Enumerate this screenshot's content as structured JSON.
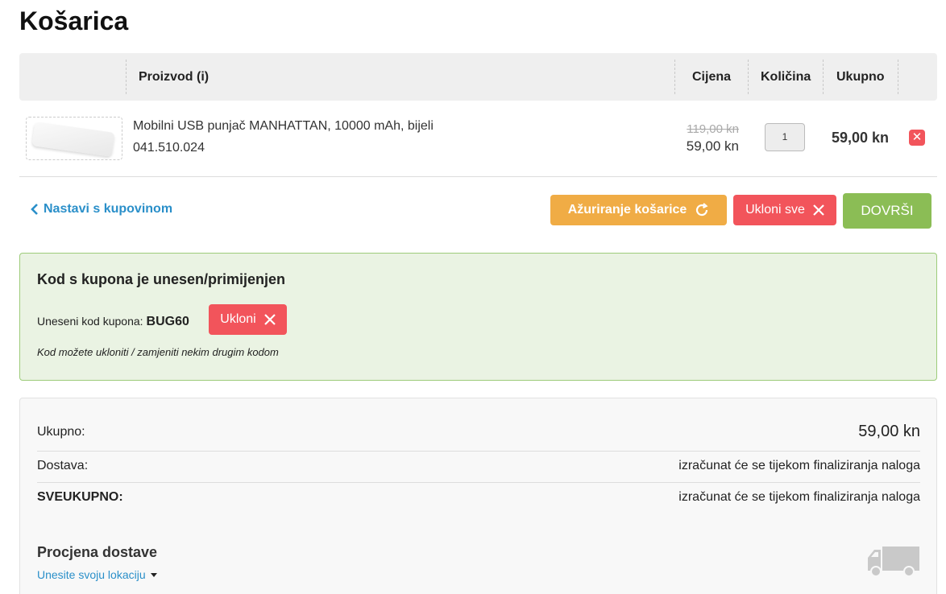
{
  "page": {
    "title": "Košarica"
  },
  "table": {
    "headers": {
      "product": "Proizvod (i)",
      "price": "Cijena",
      "qty": "Količina",
      "total": "Ukupno"
    },
    "rows": [
      {
        "name": "Mobilni USB punjač MANHATTAN, 10000 mAh, bijeli",
        "code": "041.510.024",
        "old_price": "119,00 kn",
        "price": "59,00 kn",
        "quantity": "1",
        "total": "59,00 kn"
      }
    ]
  },
  "actions": {
    "continue": "Nastavi s kupovinom",
    "update": "Ažuriranje košarice",
    "remove_all": "Ukloni sve",
    "finish": "DOVRŠI"
  },
  "coupon": {
    "title": "Kod s kupona je unesen/primijenjen",
    "label": "Uneseni kod kupona:",
    "code": "BUG60",
    "remove": "Ukloni",
    "note": "Kod možete ukloniti / zamjeniti nekim drugim kodom"
  },
  "summary": {
    "subtotal_label": "Ukupno:",
    "subtotal_value": "59,00 kn",
    "shipping_label": "Dostava:",
    "shipping_value": "izračunat će se tijekom finaliziranja naloga",
    "grand_label": "SVEUKUPNO:",
    "grand_value": "izračunat će se tijekom finaliziranja naloga",
    "estimate_title": "Procjena dostave",
    "estimate_link": "Unesite svoju lokaciju"
  },
  "colors": {
    "accent_blue": "#2a8fc9",
    "orange": "#f0ac45",
    "red": "#f2545b",
    "green": "#8bbd55"
  }
}
